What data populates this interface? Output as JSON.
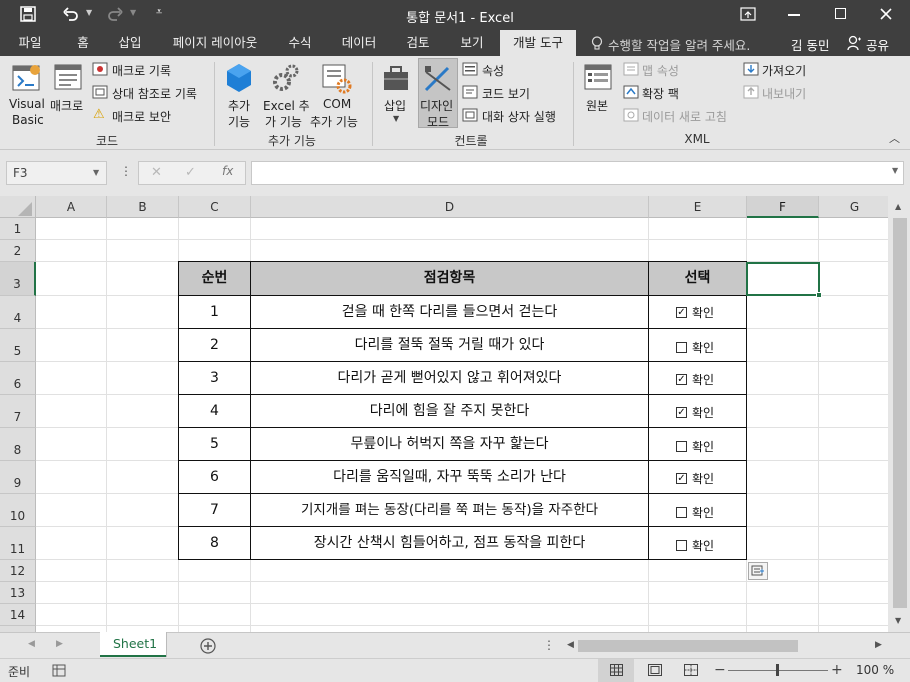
{
  "titlebar": {
    "title": "통합 문서1 - Excel"
  },
  "tabs": [
    {
      "label": "파일"
    },
    {
      "label": "홈"
    },
    {
      "label": "삽입"
    },
    {
      "label": "페이지 레이아웃"
    },
    {
      "label": "수식"
    },
    {
      "label": "데이터"
    },
    {
      "label": "검토"
    },
    {
      "label": "보기"
    },
    {
      "label": "개발 도구"
    }
  ],
  "tellme": "수행할 작업을 알려 주세요.",
  "user": "김 동민",
  "share": "공유",
  "ribbon": {
    "code": {
      "visual_basic_1": "Visual",
      "visual_basic_2": "Basic",
      "macro": "매크로",
      "record_macro": "매크로 기록",
      "relative_ref": "상대 참조로 기록",
      "macro_security": "매크로 보안",
      "group": "코드"
    },
    "addins": {
      "addins_1": "추가",
      "addins_2": "기능",
      "excel_addins_1": "Excel 추",
      "excel_addins_2": "가 기능",
      "com_addins_1": "COM",
      "com_addins_2": "추가 기능",
      "group": "추가 기능"
    },
    "controls": {
      "insert": "삽입",
      "design_1": "디자인",
      "design_2": "모드",
      "properties": "속성",
      "view_code": "코드 보기",
      "run_dialog": "대화 상자 실행",
      "group": "컨트롤"
    },
    "xml": {
      "source": "원본",
      "map_properties": "맵 속성",
      "expansion_packs": "확장 팩",
      "refresh_data": "데이터 새로 고침",
      "import": "가져오기",
      "export": "내보내기",
      "group": "XML"
    }
  },
  "formula_bar": {
    "name_box": "F3",
    "fx": "fx",
    "content": ""
  },
  "columns": [
    "A",
    "B",
    "C",
    "D",
    "E",
    "F",
    "G"
  ],
  "rows": [
    "1",
    "2",
    "3",
    "4",
    "5",
    "6",
    "7",
    "8",
    "9",
    "10",
    "11",
    "12",
    "13",
    "14"
  ],
  "table": {
    "headers": [
      "순번",
      "점검항목",
      "선택"
    ],
    "check_label": "확인",
    "rows": [
      {
        "num": "1",
        "item": "걷을 때 한쪽 다리를 들으면서 걷는다",
        "checked": true
      },
      {
        "num": "2",
        "item": "다리를 절뚝 절뚝 거릴 때가 있다",
        "checked": false
      },
      {
        "num": "3",
        "item": "다리가 곧게 뻗어있지 않고 휘어져있다",
        "checked": true
      },
      {
        "num": "4",
        "item": "다리에 힘을 잘 주지 못한다",
        "checked": true
      },
      {
        "num": "5",
        "item": "무릎이나 허벅지 쪽을 자꾸 핥는다",
        "checked": false
      },
      {
        "num": "6",
        "item": "다리를 움직일때, 자꾸 뚝뚝 소리가 난다",
        "checked": true
      },
      {
        "num": "7",
        "item": "기지개를 펴는 동장(다리를 쭉 펴는 동작)을 자주한다",
        "checked": false
      },
      {
        "num": "8",
        "item": "장시간 산책시 힘들어하고, 점프 동작을 피한다",
        "checked": false
      }
    ]
  },
  "sheet_tab": "Sheet1",
  "status": {
    "ready": "준비",
    "zoom": "100 %"
  },
  "colors": {
    "chrome_dark": "#3f3f3f",
    "ribbon_bg": "#e6e6e6",
    "select_green": "#217346",
    "header_fill": "#c8c8c8"
  }
}
